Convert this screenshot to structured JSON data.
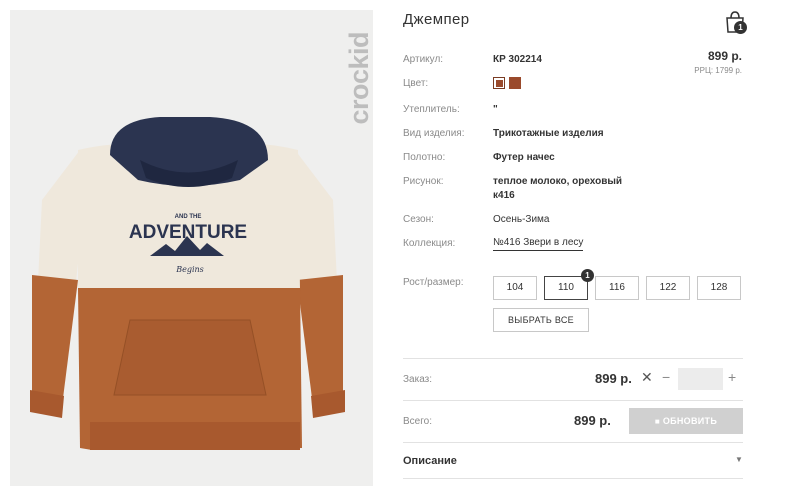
{
  "product": {
    "title": "Джемпер",
    "brand": "crockid",
    "print_line1": "AND THE",
    "print_line2": "ADVENTURE",
    "print_line3": "Begins",
    "price": "899 р.",
    "rrp": "РРЦ: 1799 р."
  },
  "cart": {
    "badge": "1"
  },
  "details": {
    "article_label": "Артикул:",
    "article_value": "КР 302214",
    "color_label": "Цвет:",
    "insulation_label": "Утеплитель:",
    "insulation_value": "\"",
    "type_label": "Вид изделия:",
    "type_value": "Трикотажные изделия",
    "fabric_label": "Полотно:",
    "fabric_value": "Футер начес",
    "pattern_label": "Рисунок:",
    "pattern_value_line1": "теплое молоко, ореховый",
    "pattern_value_line2": "к416",
    "season_label": "Сезон:",
    "season_value": "Осень-Зима",
    "collection_label": "Коллекция:",
    "collection_value": "№416 Звери в лесу"
  },
  "colors": [
    "#9a4a2c",
    "#9a4a2c"
  ],
  "sizes": {
    "label": "Рост/размер:",
    "options": [
      "104",
      "110",
      "116",
      "122",
      "128"
    ],
    "selected": "110",
    "badge": "1",
    "select_all": "ВЫБРАТЬ ВСЕ"
  },
  "order": {
    "label": "Заказ:",
    "price": "899 р.",
    "qty_value": ""
  },
  "total": {
    "label": "Всего:",
    "price": "899 р.",
    "update_label": "ОБНОВИТЬ"
  },
  "description": {
    "label": "Описание"
  }
}
